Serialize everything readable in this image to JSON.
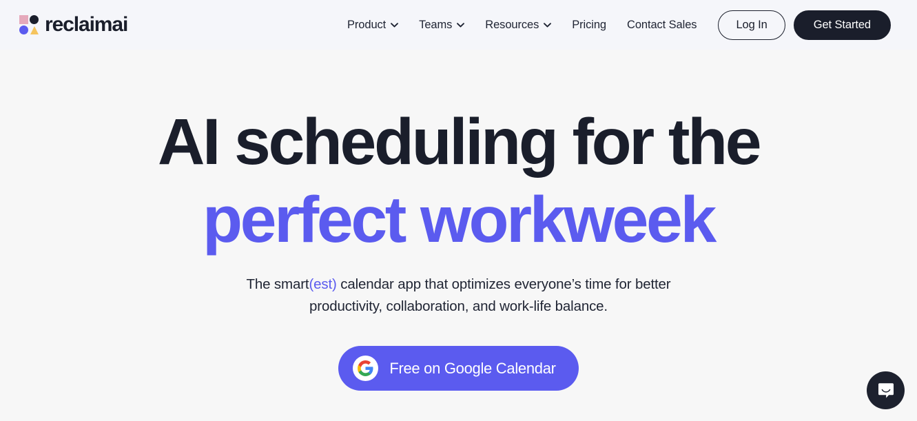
{
  "header": {
    "brand": {
      "wordmark": "reclaimai",
      "logo_icon": "reclaim-logo-mark",
      "colors": {
        "square": "#e5a9bb",
        "circle_dark": "#1a1e2b",
        "circle_blue": "#5b5bef",
        "triangle": "#f5c45e"
      }
    },
    "nav": [
      {
        "label": "Product",
        "has_dropdown": true,
        "icon": "chevron-down-icon"
      },
      {
        "label": "Teams",
        "has_dropdown": true,
        "icon": "chevron-down-icon"
      },
      {
        "label": "Resources",
        "has_dropdown": true,
        "icon": "chevron-down-icon"
      },
      {
        "label": "Pricing",
        "has_dropdown": false
      },
      {
        "label": "Contact Sales",
        "has_dropdown": false
      }
    ],
    "login_label": "Log In",
    "get_started_label": "Get Started"
  },
  "hero": {
    "headline_line1": "AI scheduling for the",
    "headline_line2": "perfect workweek",
    "subhead_part1": "The smart",
    "subhead_accent": "(est)",
    "subhead_part2": " calendar app that optimizes everyone’s time for better productivity, collaboration, and work-life balance.",
    "cta_label": "Free on Google Calendar",
    "cta_icon": "google-g-icon"
  },
  "chat": {
    "icon": "intercom-chat-bubble-icon",
    "aria_label": "Open Intercom Messenger"
  },
  "colors": {
    "accent_indigo": "#5b5bef",
    "ink_navy": "#1a1e2b",
    "page_bg": "#f7f7f7",
    "header_bg": "#f5f6fa"
  }
}
